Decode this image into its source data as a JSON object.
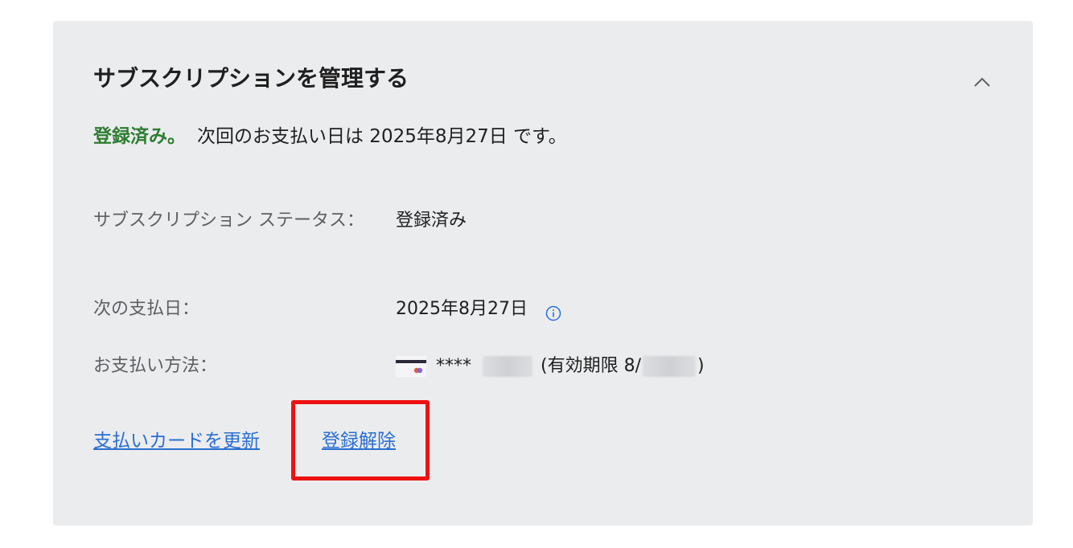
{
  "panel": {
    "title": "サブスクリプションを管理する",
    "collapse_icon": "chevron-up-icon"
  },
  "summary": {
    "status_highlight": "登録済み。",
    "next_payment_text": "次回のお支払い日は 2025年8月27日 です。",
    "status_color": "#2e7d32"
  },
  "details": {
    "status_label": "サブスクリプション ステータス：",
    "status_value": "登録済み",
    "next_payment_label": "次の支払日：",
    "next_payment_value": "2025年8月27日",
    "info_icon": "info-icon",
    "payment_method_label": "お支払い方法：",
    "card_mask": "****",
    "expiry_prefix": "(有効期限 8/",
    "expiry_suffix": ")",
    "card_icon": "credit-card-icon"
  },
  "actions": {
    "update_card_label": "支払いカードを更新",
    "unsubscribe_label": "登録解除",
    "link_color": "#2b6fd1",
    "highlight_color": "#ee1111"
  }
}
